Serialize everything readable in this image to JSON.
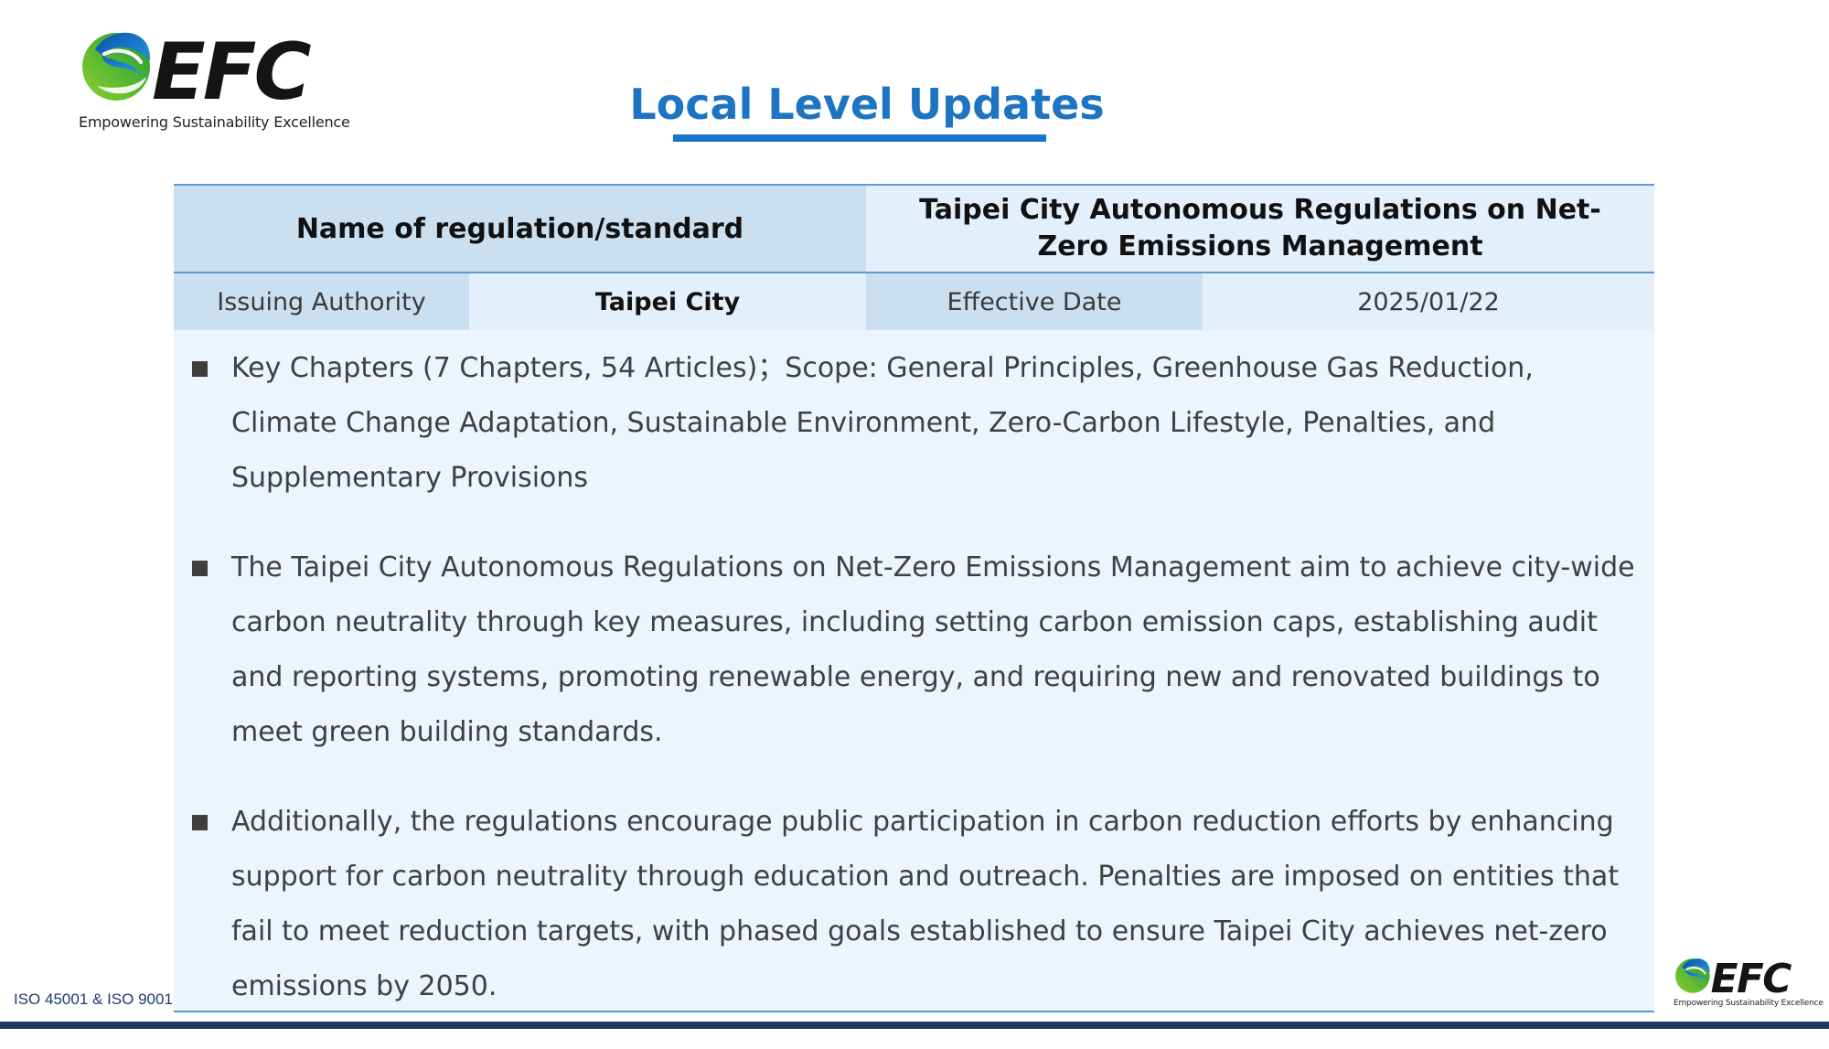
{
  "brand": {
    "name": "EFC",
    "tagline": "Empowering Sustainability Excellence"
  },
  "title": "Local Level Updates",
  "table": {
    "name_label": "Name of regulation/standard",
    "name_value": "Taipei City Autonomous Regulations on Net-Zero Emissions Management",
    "authority_label": "Issuing Authority",
    "authority_value": "Taipei City",
    "date_label": "Effective Date",
    "date_value": "2025/01/22"
  },
  "bullets": [
    "Key Chapters (7 Chapters, 54 Articles)；Scope: General Principles, Greenhouse Gas Reduction, Climate Change Adaptation, Sustainable Environment, Zero-Carbon Lifestyle, Penalties, and Supplementary Provisions",
    "The Taipei City Autonomous Regulations on Net-Zero Emissions Management aim to achieve city-wide carbon neutrality through key measures, including setting carbon emission caps, establishing audit and reporting systems, promoting renewable energy, and requiring new and renovated buildings to meet green building standards.",
    "Additionally, the regulations encourage public participation in carbon reduction efforts by enhancing support for carbon neutrality through education and outreach. Penalties are imposed on entities that fail to meet reduction targets, with phased goals established to ensure Taipei City achieves net-zero emissions by 2050."
  ],
  "footer": {
    "iso": "ISO 45001 & ISO 9001"
  },
  "colors": {
    "title_blue": "#1d74c2",
    "header_cell": "#cae0f1",
    "value_cell": "#e3effb",
    "panel_bg": "#ecf4fd",
    "footer_bar": "#1f3864"
  },
  "icons": {
    "logo_mark": "green-blue-swirl-logo",
    "bullet": "filled-square"
  }
}
